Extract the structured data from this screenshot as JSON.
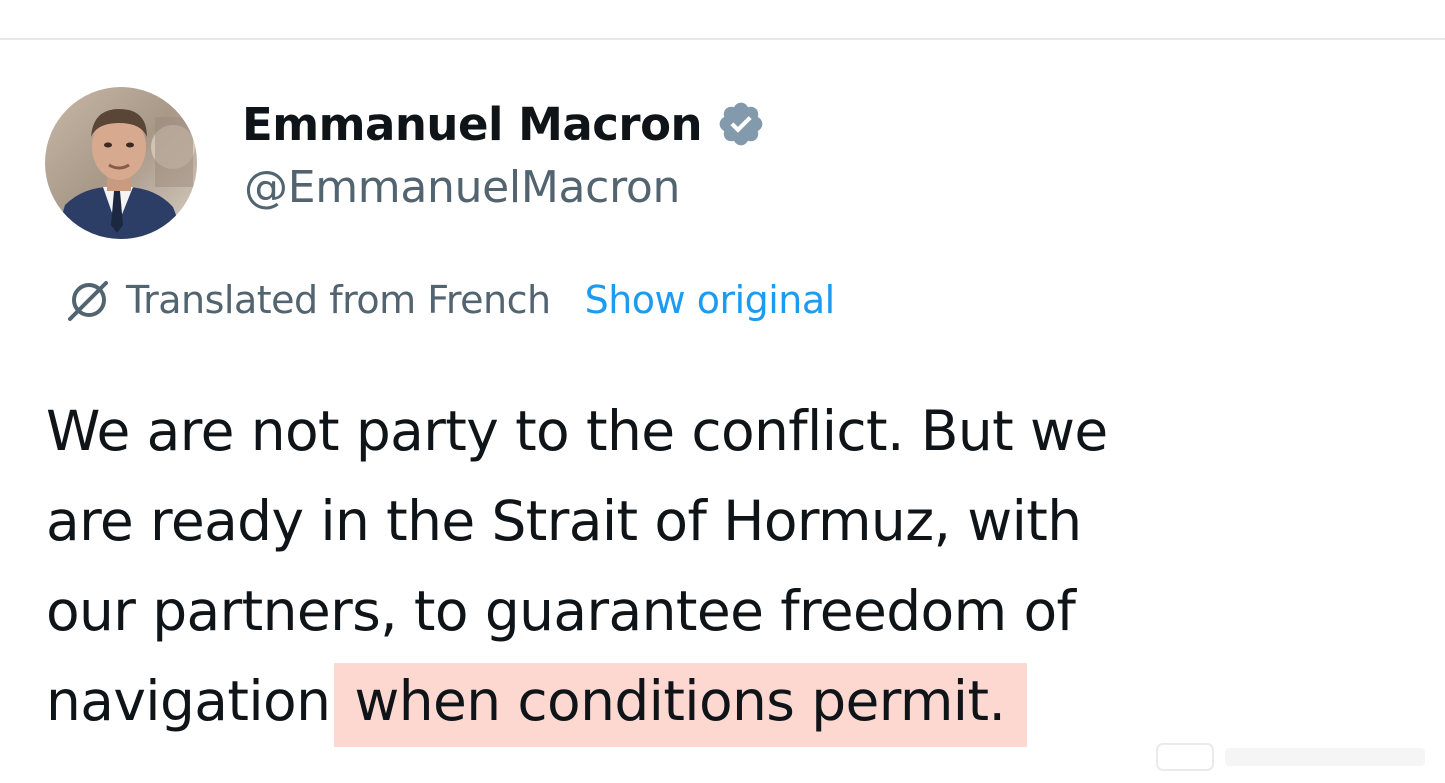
{
  "author": {
    "display_name": "Emmanuel Macron",
    "handle": "@EmmanuelMacron",
    "verified_badge_color": "#829aab"
  },
  "translation": {
    "label": "Translated from French",
    "show_original": "Show original",
    "link_color": "#1d9bf0"
  },
  "tweet": {
    "lines": [
      "We are not party to the conflict. But we",
      "are ready in the Strait of Hormuz, with",
      "our partners, to guarantee freedom of",
      "navigation"
    ],
    "highlighted": "when conditions permit.",
    "highlight_color": "#fcd8d0"
  }
}
